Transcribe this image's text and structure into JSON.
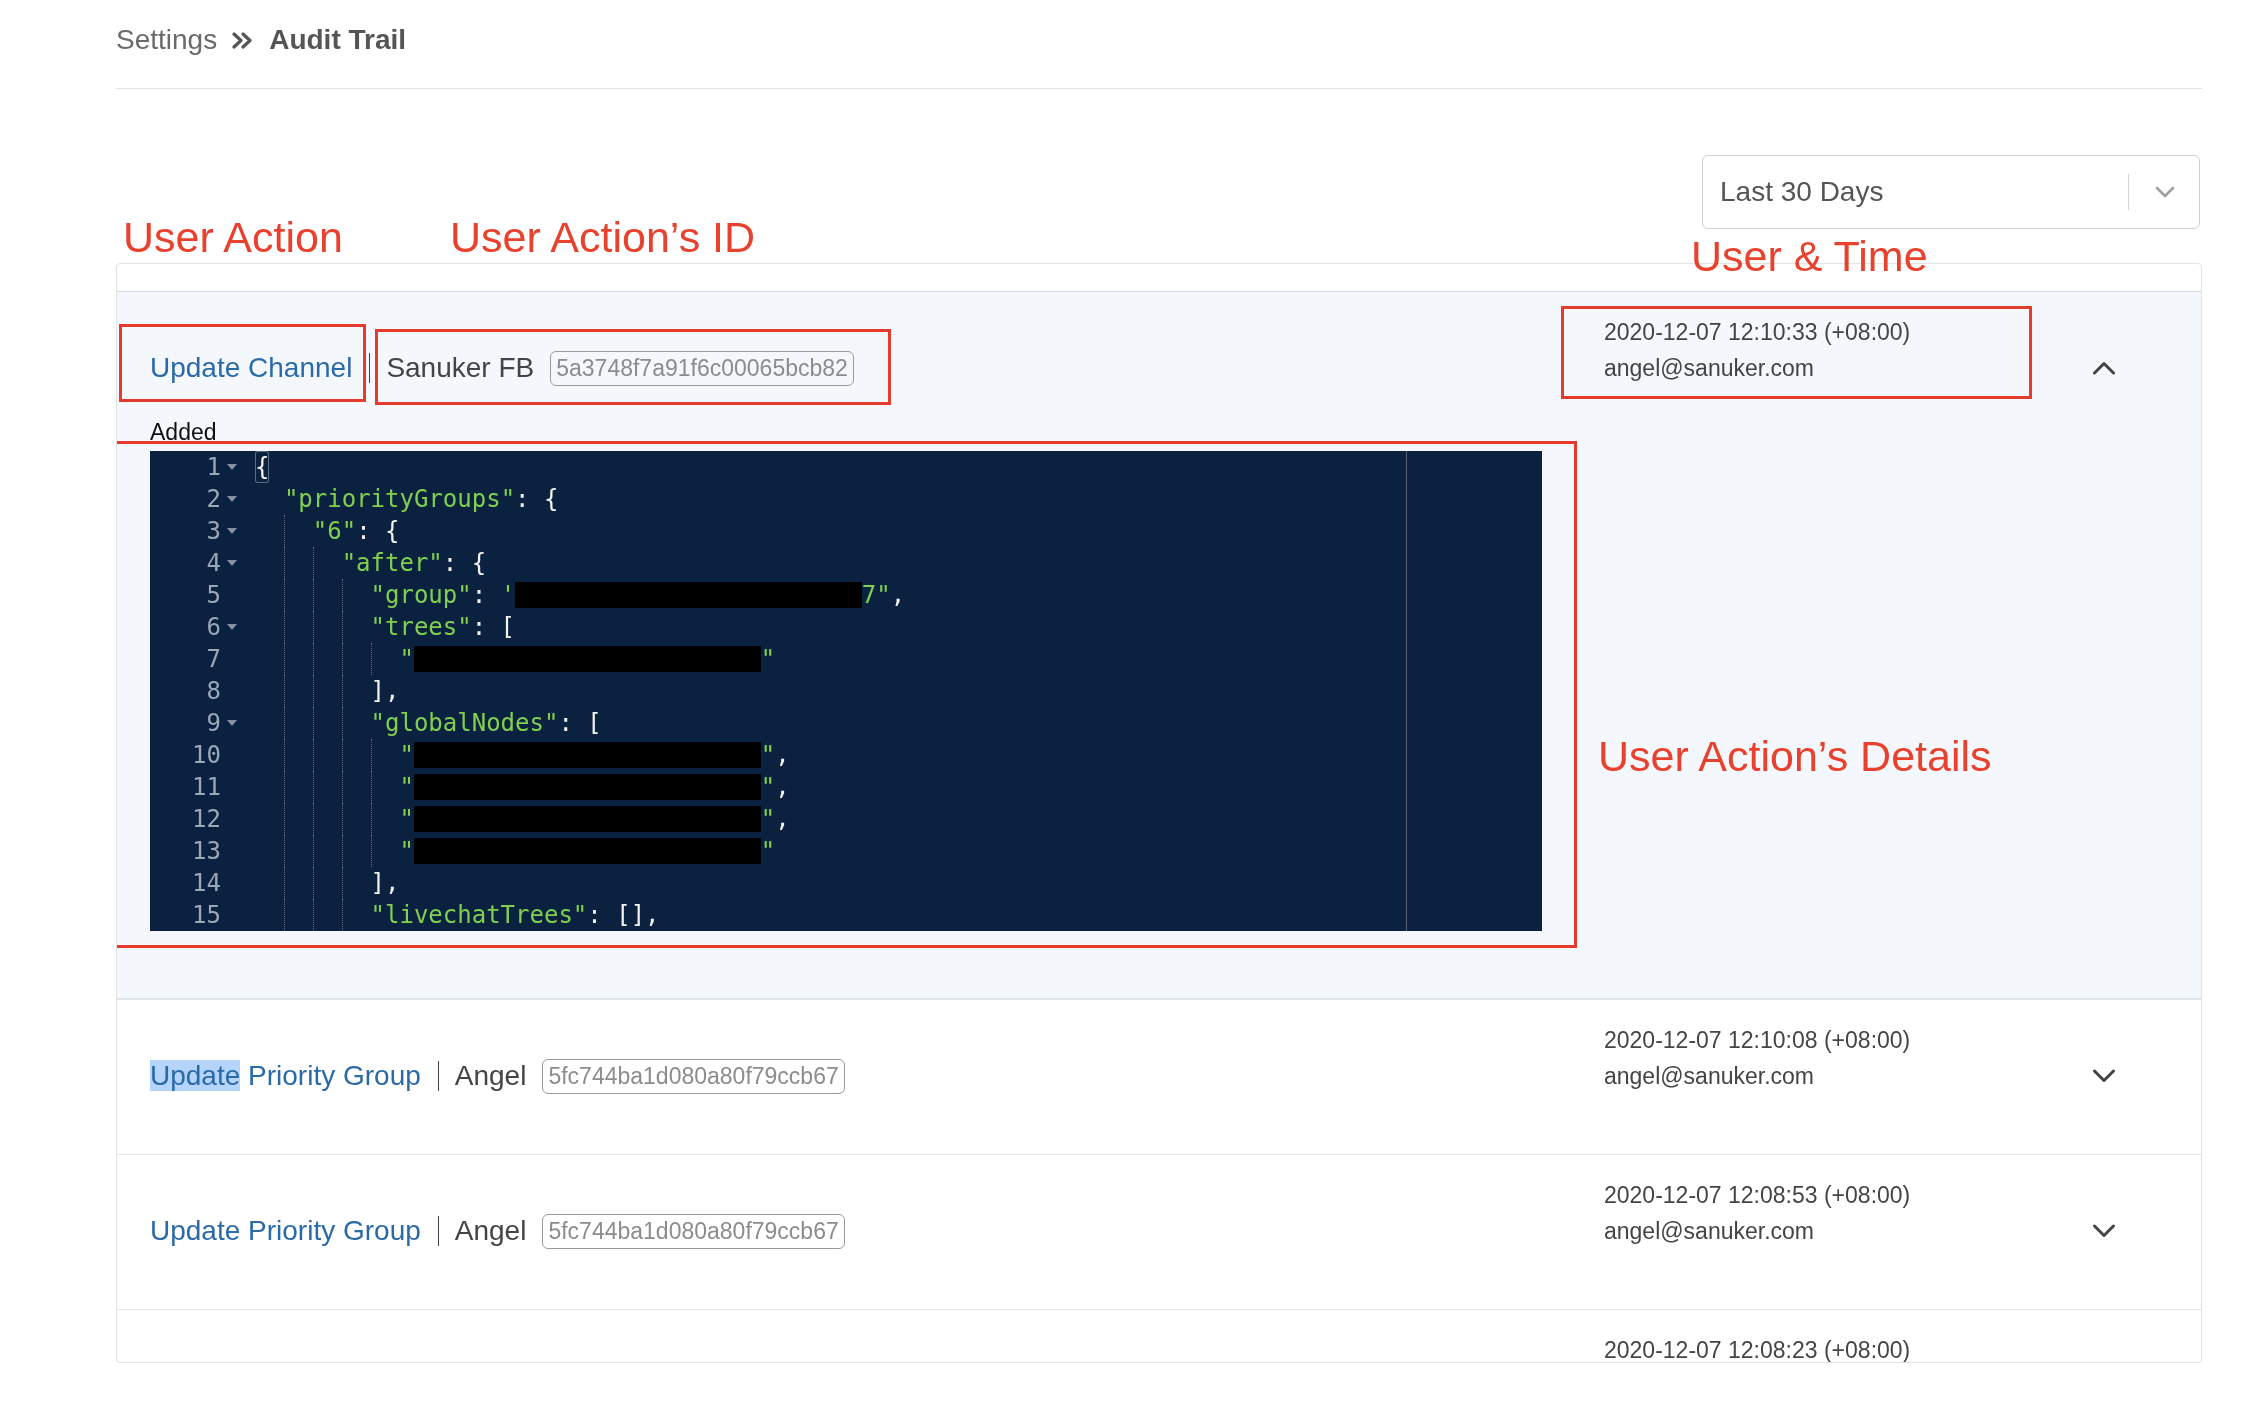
{
  "breadcrumb": [
    {
      "label": "Settings",
      "current": false
    },
    {
      "label": "Audit Trail",
      "current": true
    }
  ],
  "filter": {
    "value": "Last 30 Days"
  },
  "annotations": [
    {
      "text": "User Action",
      "kind": "action"
    },
    {
      "text": "User Action’s ID",
      "kind": "id"
    },
    {
      "text": "User & Time",
      "kind": "user"
    },
    {
      "text": "User Action’s Details",
      "kind": "details"
    }
  ],
  "entries": [
    {
      "action": [
        {
          "text": "Update Channel",
          "highlighted": false
        }
      ],
      "target": "Sanuker FB",
      "record_id": "5a3748f7a91f6c00065bcb82",
      "time": "2020-12-07 12:10:33 (+08:00)",
      "user": "angel@sanuker.com",
      "expanded": true,
      "annotated": true,
      "details": {
        "label": "Added",
        "lines": [
          {
            "number": "1",
            "foldable": true,
            "tokens": [
              {
                "kind": "bracket",
                "text": "{"
              }
            ],
            "children": [
              {
                "number": "2",
                "foldable": true,
                "tokens": [
                  {
                    "kind": "string",
                    "text": "\"priorityGroups\""
                  },
                  {
                    "kind": "punct",
                    "text": ": {"
                  }
                ],
                "children": [
                  {
                    "number": "3",
                    "foldable": true,
                    "tokens": [
                      {
                        "kind": "string",
                        "text": "\"6\""
                      },
                      {
                        "kind": "punct",
                        "text": ": {"
                      }
                    ],
                    "children": [
                      {
                        "number": "4",
                        "foldable": true,
                        "tokens": [
                          {
                            "kind": "string",
                            "text": "\"after\""
                          },
                          {
                            "kind": "punct",
                            "text": ": {"
                          }
                        ],
                        "children": [
                          {
                            "number": "5",
                            "foldable": false,
                            "tokens": [
                              {
                                "kind": "string",
                                "text": "\"group\""
                              },
                              {
                                "kind": "punct",
                                "text": ": "
                              },
                              {
                                "kind": "string",
                                "text": "'"
                              },
                              {
                                "kind": "redacted"
                              },
                              {
                                "kind": "string",
                                "text": "7\""
                              },
                              {
                                "kind": "punct",
                                "text": ","
                              }
                            ]
                          },
                          {
                            "number": "6",
                            "foldable": true,
                            "tokens": [
                              {
                                "kind": "string",
                                "text": "\"trees\""
                              },
                              {
                                "kind": "punct",
                                "text": ": ["
                              }
                            ],
                            "children": [
                              {
                                "number": "7",
                                "foldable": false,
                                "tokens": [
                                  {
                                    "kind": "string",
                                    "text": "\""
                                  },
                                  {
                                    "kind": "redacted"
                                  },
                                  {
                                    "kind": "string",
                                    "text": "\""
                                  }
                                ]
                              }
                            ]
                          },
                          {
                            "number": "8",
                            "foldable": false,
                            "tokens": [
                              {
                                "kind": "punct",
                                "text": "],"
                              }
                            ]
                          },
                          {
                            "number": "9",
                            "foldable": true,
                            "tokens": [
                              {
                                "kind": "string",
                                "text": "\"globalNodes\""
                              },
                              {
                                "kind": "punct",
                                "text": ": ["
                              }
                            ],
                            "children": [
                              {
                                "number": "10",
                                "foldable": false,
                                "tokens": [
                                  {
                                    "kind": "string",
                                    "text": "\""
                                  },
                                  {
                                    "kind": "redacted"
                                  },
                                  {
                                    "kind": "string",
                                    "text": "\""
                                  },
                                  {
                                    "kind": "punct",
                                    "text": ","
                                  }
                                ]
                              },
                              {
                                "number": "11",
                                "foldable": false,
                                "tokens": [
                                  {
                                    "kind": "string",
                                    "text": "\""
                                  },
                                  {
                                    "kind": "redacted"
                                  },
                                  {
                                    "kind": "string",
                                    "text": "\""
                                  },
                                  {
                                    "kind": "punct",
                                    "text": ","
                                  }
                                ]
                              },
                              {
                                "number": "12",
                                "foldable": false,
                                "tokens": [
                                  {
                                    "kind": "string",
                                    "text": "\""
                                  },
                                  {
                                    "kind": "redacted"
                                  },
                                  {
                                    "kind": "string",
                                    "text": "\""
                                  },
                                  {
                                    "kind": "punct",
                                    "text": ","
                                  }
                                ]
                              },
                              {
                                "number": "13",
                                "foldable": false,
                                "tokens": [
                                  {
                                    "kind": "string",
                                    "text": "\""
                                  },
                                  {
                                    "kind": "redacted"
                                  },
                                  {
                                    "kind": "string",
                                    "text": "\""
                                  }
                                ]
                              }
                            ]
                          },
                          {
                            "number": "14",
                            "foldable": false,
                            "tokens": [
                              {
                                "kind": "punct",
                                "text": "],"
                              }
                            ]
                          },
                          {
                            "number": "15",
                            "foldable": false,
                            "tokens": [
                              {
                                "kind": "string",
                                "text": "\"livechatTrees\""
                              },
                              {
                                "kind": "punct",
                                "text": ": [],"
                              }
                            ]
                          }
                        ]
                      }
                    ]
                  }
                ]
              }
            ]
          }
        ]
      }
    },
    {
      "action": [
        {
          "text": "Update",
          "highlighted": true
        },
        {
          "text": " Priority Group",
          "highlighted": false
        }
      ],
      "target": "Angel",
      "record_id": "5fc744ba1d080a80f79ccb67",
      "time": "2020-12-07 12:10:08 (+08:00)",
      "user": "angel@sanuker.com",
      "expanded": false,
      "annotated": false
    },
    {
      "action": [
        {
          "text": "Update Priority Group",
          "highlighted": false
        }
      ],
      "target": "Angel",
      "record_id": "5fc744ba1d080a80f79ccb67",
      "time": "2020-12-07 12:08:53 (+08:00)",
      "user": "angel@sanuker.com",
      "expanded": false,
      "annotated": false
    },
    {
      "time": "2020-12-07 12:08:23 (+08:00)",
      "annotated": false
    }
  ]
}
